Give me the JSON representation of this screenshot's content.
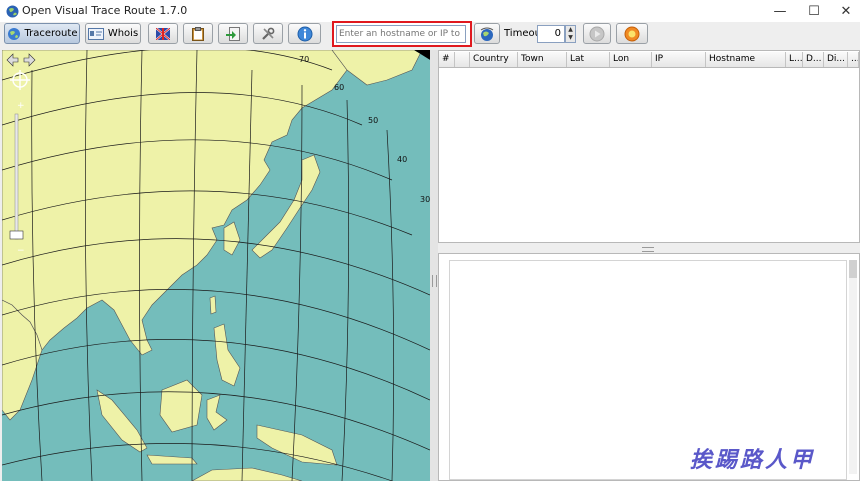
{
  "window": {
    "title": "Open Visual Trace Route 1.7.0",
    "minimize": "—",
    "maximize": "☐",
    "close": "✕"
  },
  "toolbar": {
    "traceroute_label": "Traceroute",
    "whois_label": "Whois",
    "host_placeholder": "Enter an hostname or IP to traceroute",
    "timeout_label": "Timeout",
    "timeout_value": "0"
  },
  "table": {
    "columns": [
      "#",
      "",
      "Country",
      "Town",
      "Lat",
      "Lon",
      "IP",
      "Hostname",
      "L...",
      "D...",
      "Di...",
      "..."
    ]
  },
  "map": {
    "latitude_labels": [
      "70",
      "60",
      "50",
      "40",
      "30"
    ]
  },
  "watermark": "挨踢路人甲",
  "colors": {
    "ocean": "#74bdbb",
    "land": "#eef2a8",
    "highlight": "#e0191f"
  }
}
